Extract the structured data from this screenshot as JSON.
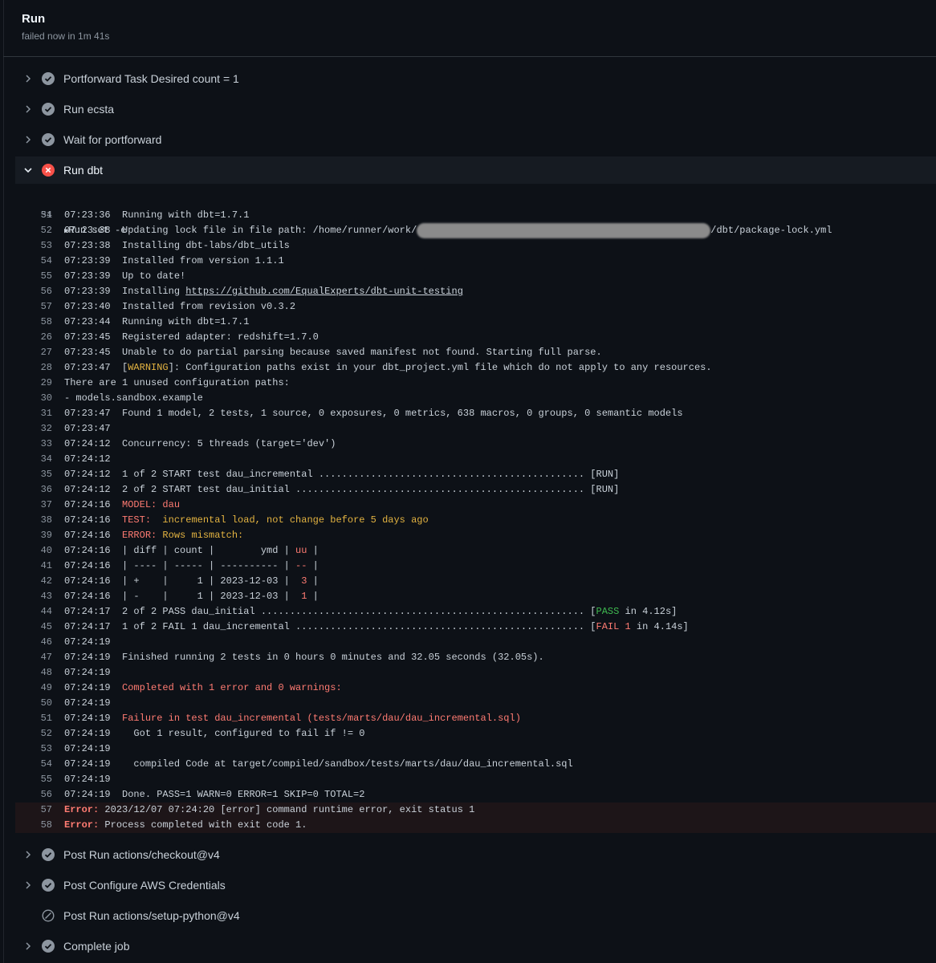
{
  "header": {
    "title": "Run",
    "subtitle": "failed now in 1m 41s"
  },
  "steps_before": [
    {
      "name": "Portforward Task Desired count = 1",
      "status": "success"
    },
    {
      "name": "Run ecsta",
      "status": "success"
    },
    {
      "name": "Wait for portforward",
      "status": "success"
    }
  ],
  "open_step": {
    "name": "Run dbt",
    "status": "failure"
  },
  "log": {
    "group_line": {
      "no": "34",
      "text": "Run set -e"
    },
    "lines": [
      {
        "no": "51",
        "segs": [
          {
            "t": "07:23:36  Running with dbt=1.7.1"
          }
        ]
      },
      {
        "no": "52",
        "segs": [
          {
            "t": "07:23:38  Updating lock file in file path: /home/runner/work/"
          },
          {
            "c": "blur"
          },
          {
            "t": "/dbt/package-lock.yml"
          }
        ]
      },
      {
        "no": "53",
        "segs": [
          {
            "t": "07:23:38  Installing dbt-labs/dbt_utils"
          }
        ]
      },
      {
        "no": "54",
        "segs": [
          {
            "t": "07:23:39  Installed from version 1.1.1"
          }
        ]
      },
      {
        "no": "55",
        "segs": [
          {
            "t": "07:23:39  Up to date!"
          }
        ]
      },
      {
        "no": "56",
        "segs": [
          {
            "t": "07:23:39  Installing "
          },
          {
            "t": "https://github.com/EqualExperts/dbt-unit-testing",
            "c": "ul"
          }
        ]
      },
      {
        "no": "57",
        "segs": [
          {
            "t": "07:23:40  Installed from revision v0.3.2"
          }
        ]
      },
      {
        "no": "58",
        "segs": [
          {
            "t": "07:23:44  Running with dbt=1.7.1"
          }
        ]
      },
      {
        "no": "26",
        "segs": [
          {
            "t": "07:23:45  Registered adapter: redshift=1.7.0"
          }
        ]
      },
      {
        "no": "27",
        "segs": [
          {
            "t": "07:23:45  Unable to do partial parsing because saved manifest not found. Starting full parse."
          }
        ]
      },
      {
        "no": "28",
        "segs": [
          {
            "t": "07:23:47  ["
          },
          {
            "t": "WARNING",
            "c": "c-org"
          },
          {
            "t": "]: Configuration paths exist in your dbt_project.yml file which do not apply to any resources."
          }
        ]
      },
      {
        "no": "29",
        "segs": [
          {
            "t": "There are 1 unused configuration paths:"
          }
        ]
      },
      {
        "no": "30",
        "segs": [
          {
            "t": "- models.sandbox.example"
          }
        ]
      },
      {
        "no": "31",
        "segs": [
          {
            "t": "07:23:47  Found 1 model, 2 tests, 1 source, 0 exposures, 0 metrics, 638 macros, 0 groups, 0 semantic models"
          }
        ]
      },
      {
        "no": "32",
        "segs": [
          {
            "t": "07:23:47"
          }
        ]
      },
      {
        "no": "33",
        "segs": [
          {
            "t": "07:24:12  Concurrency: 5 threads (target='dev')"
          }
        ]
      },
      {
        "no": "34",
        "segs": [
          {
            "t": "07:24:12"
          }
        ]
      },
      {
        "no": "35",
        "segs": [
          {
            "t": "07:24:12  1 of 2 START test dau_incremental .............................................. [RUN]"
          }
        ]
      },
      {
        "no": "36",
        "segs": [
          {
            "t": "07:24:12  2 of 2 START test dau_initial .................................................. [RUN]"
          }
        ]
      },
      {
        "no": "37",
        "segs": [
          {
            "t": "07:24:16  "
          },
          {
            "t": "MODEL: dau",
            "c": "c-red"
          }
        ]
      },
      {
        "no": "38",
        "segs": [
          {
            "t": "07:24:16  "
          },
          {
            "t": "TEST:",
            "c": "c-red"
          },
          {
            "t": "  incremental load, not change before 5 days ago",
            "c": "c-org"
          }
        ]
      },
      {
        "no": "39",
        "segs": [
          {
            "t": "07:24:16  "
          },
          {
            "t": "ERROR:",
            "c": "c-red"
          },
          {
            "t": " Rows mismatch:",
            "c": "c-org"
          }
        ]
      },
      {
        "no": "40",
        "segs": [
          {
            "t": "07:24:16  | diff | count |        ymd | "
          },
          {
            "t": "uu",
            "c": "c-red"
          },
          {
            "t": " |"
          }
        ]
      },
      {
        "no": "41",
        "segs": [
          {
            "t": "07:24:16  | ---- | ----- | ---------- | "
          },
          {
            "t": "--",
            "c": "c-red"
          },
          {
            "t": " |"
          }
        ]
      },
      {
        "no": "42",
        "segs": [
          {
            "t": "07:24:16  | +    |     1 | 2023-12-03 |  "
          },
          {
            "t": "3",
            "c": "c-red"
          },
          {
            "t": " |"
          }
        ]
      },
      {
        "no": "43",
        "segs": [
          {
            "t": "07:24:16  | -    |     1 | 2023-12-03 |  "
          },
          {
            "t": "1",
            "c": "c-red"
          },
          {
            "t": " |"
          }
        ]
      },
      {
        "no": "44",
        "segs": [
          {
            "t": "07:24:17  2 of 2 PASS dau_initial ........................................................ ["
          },
          {
            "t": "PASS",
            "c": "c-grn"
          },
          {
            "t": " in 4.12s]"
          }
        ]
      },
      {
        "no": "45",
        "segs": [
          {
            "t": "07:24:17  1 of 2 FAIL 1 dau_incremental .................................................. ["
          },
          {
            "t": "FAIL 1",
            "c": "c-red"
          },
          {
            "t": " in 4.14s]"
          }
        ]
      },
      {
        "no": "46",
        "segs": [
          {
            "t": "07:24:19"
          }
        ]
      },
      {
        "no": "47",
        "segs": [
          {
            "t": "07:24:19  Finished running 2 tests in 0 hours 0 minutes and 32.05 seconds (32.05s)."
          }
        ]
      },
      {
        "no": "48",
        "segs": [
          {
            "t": "07:24:19"
          }
        ]
      },
      {
        "no": "49",
        "segs": [
          {
            "t": "07:24:19  "
          },
          {
            "t": "Completed with 1 error and 0 warnings:",
            "c": "c-red"
          }
        ]
      },
      {
        "no": "50",
        "segs": [
          {
            "t": "07:24:19"
          }
        ]
      },
      {
        "no": "51",
        "segs": [
          {
            "t": "07:24:19  "
          },
          {
            "t": "Failure in test dau_incremental (tests/marts/dau/dau_incremental.sql)",
            "c": "c-red"
          }
        ]
      },
      {
        "no": "52",
        "segs": [
          {
            "t": "07:24:19    Got 1 result, configured to fail if != 0"
          }
        ]
      },
      {
        "no": "53",
        "segs": [
          {
            "t": "07:24:19"
          }
        ]
      },
      {
        "no": "54",
        "segs": [
          {
            "t": "07:24:19    compiled Code at target/compiled/sandbox/tests/marts/dau/dau_incremental.sql"
          }
        ]
      },
      {
        "no": "55",
        "segs": [
          {
            "t": "07:24:19"
          }
        ]
      },
      {
        "no": "56",
        "segs": [
          {
            "t": "07:24:19  Done. PASS=1 WARN=0 ERROR=1 SKIP=0 TOTAL=2"
          }
        ]
      },
      {
        "no": "57",
        "err": true,
        "segs": [
          {
            "t": "Error:",
            "c": "c-red c-b"
          },
          {
            "t": " 2023/12/07 07:24:20 [error] command runtime error, exit status 1"
          }
        ]
      },
      {
        "no": "58",
        "err": true,
        "segs": [
          {
            "t": "Error:",
            "c": "c-red c-b"
          },
          {
            "t": " Process completed with exit code 1."
          }
        ]
      }
    ]
  },
  "steps_after": [
    {
      "name": "Post Run actions/checkout@v4",
      "status": "success"
    },
    {
      "name": "Post Configure AWS Credentials",
      "status": "success"
    },
    {
      "name": "Post Run actions/setup-python@v4",
      "status": "skipped"
    },
    {
      "name": "Complete job",
      "status": "success"
    }
  ],
  "colors": {
    "background": "#0d1117",
    "success_icon": "#8d96a0",
    "failure_icon": "#f85149",
    "error_text": "#ff7b72",
    "warning_text": "#e3b341",
    "pass_text": "#3fb950"
  }
}
